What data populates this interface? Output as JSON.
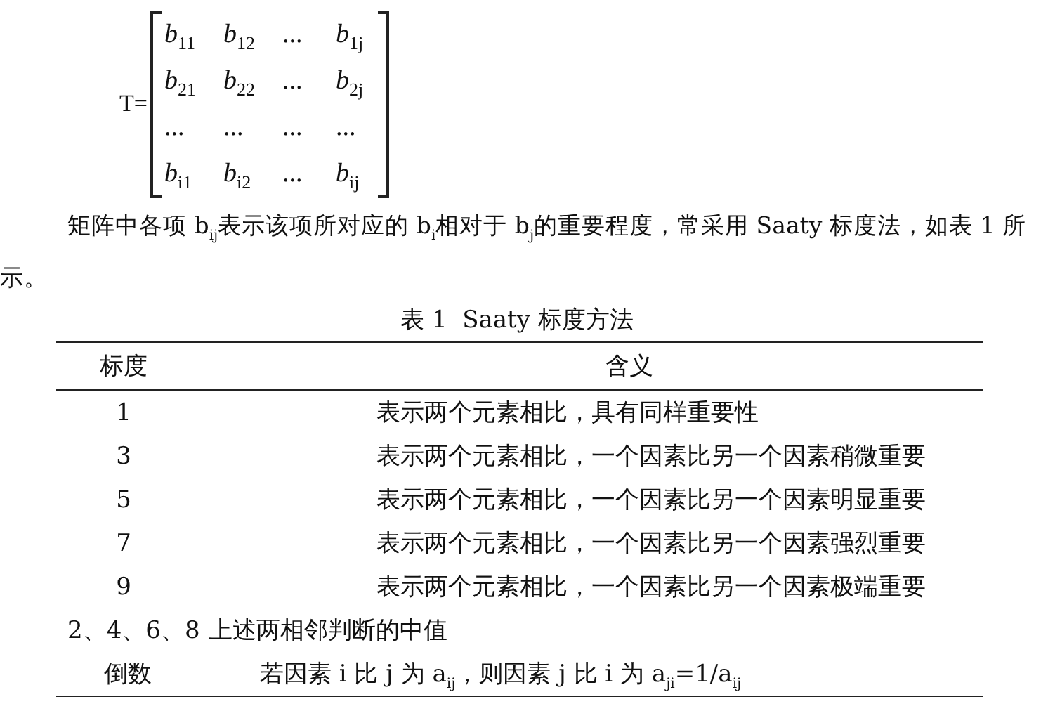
{
  "matrix": {
    "label": "T=",
    "rows": [
      [
        "*b*$_{11}$",
        "*b*$_{12}$",
        "...",
        "*b*$_{1j}$"
      ],
      [
        "*b*$_{21}$",
        "*b*$_{22}$",
        "...",
        "*b*$_{2j}$"
      ],
      [
        "...",
        "...",
        "...",
        "..."
      ],
      [
        "*b*$_{i1}$",
        "*b*$_{i2}$",
        "...",
        "*b*$_{ij}$"
      ]
    ]
  },
  "paragraph": "矩阵中各项 b$_{ij}$表示该项所对应的 b$_{i}$相对于 b$_{j}$的重要程度，常采用 Saaty 标度法，如表 1 所示。",
  "table": {
    "caption": "表 1  Saaty 标度方法",
    "columns": [
      "标度",
      "含义"
    ],
    "rows": [
      {
        "kind": "standard",
        "scale": "1",
        "meaning": "表示两个元素相比，具有同样重要性"
      },
      {
        "kind": "standard",
        "scale": "3",
        "meaning": "表示两个元素相比，一个因素比另一个因素稍微重要"
      },
      {
        "kind": "standard",
        "scale": "5",
        "meaning": "表示两个元素相比，一个因素比另一个因素明显重要"
      },
      {
        "kind": "standard",
        "scale": "7",
        "meaning": "表示两个元素相比，一个因素比另一个因素强烈重要"
      },
      {
        "kind": "standard",
        "scale": "9",
        "meaning": "表示两个元素相比，一个因素比另一个因素极端重要"
      },
      {
        "kind": "note",
        "scale": "2、4、6、8",
        "meaning": "上述两相邻判断的中值"
      },
      {
        "kind": "reciprocal",
        "scale": "倒数",
        "meaning": "若因素 i 比 j 为 a$_{ij}$，则因素 j 比 i 为 a$_{ji}$=1/a$_{ij}$"
      }
    ]
  }
}
